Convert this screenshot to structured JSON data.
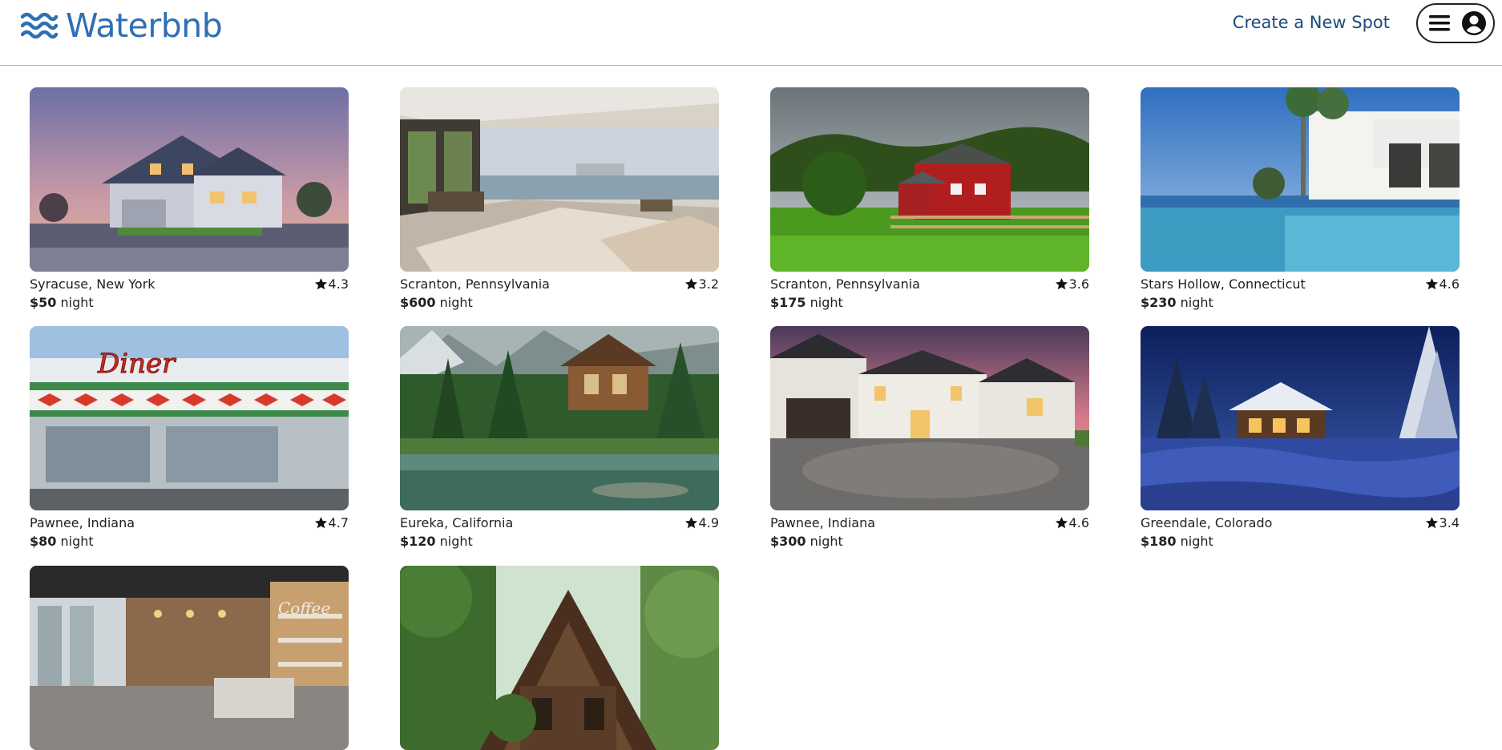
{
  "header": {
    "brand": "Waterbnb",
    "create_link": "Create a New Spot",
    "icons": {
      "logo": "waves-icon",
      "menu": "hamburger-icon",
      "profile": "user-circle-icon"
    }
  },
  "listings": [
    {
      "location": "Syracuse, New York",
      "rating": "4.3",
      "price": "$50",
      "unit": "night",
      "image": "suburban-house-photo"
    },
    {
      "location": "Scranton, Pennsylvania",
      "rating": "3.2",
      "price": "$600",
      "unit": "night",
      "image": "waterfront-bedroom-photo"
    },
    {
      "location": "Scranton, Pennsylvania",
      "rating": "3.6",
      "price": "$175",
      "unit": "night",
      "image": "red-barn-photo"
    },
    {
      "location": "Stars Hollow, Connecticut",
      "rating": "4.6",
      "price": "$230",
      "unit": "night",
      "image": "infinity-pool-villa-photo"
    },
    {
      "location": "Pawnee, Indiana",
      "rating": "4.7",
      "price": "$80",
      "unit": "night",
      "image": "diner-photo"
    },
    {
      "location": "Eureka, California",
      "rating": "4.9",
      "price": "$120",
      "unit": "night",
      "image": "lake-cabin-photo"
    },
    {
      "location": "Pawnee, Indiana",
      "rating": "4.6",
      "price": "$300",
      "unit": "night",
      "image": "modern-farmhouse-photo"
    },
    {
      "location": "Greendale, Colorado",
      "rating": "3.4",
      "price": "$180",
      "unit": "night",
      "image": "snowy-chalet-photo"
    },
    {
      "location": "",
      "rating": "",
      "price": "",
      "unit": "",
      "image": "coffee-shop-photo"
    },
    {
      "location": "",
      "rating": "",
      "price": "",
      "unit": "",
      "image": "forest-a-frame-photo"
    }
  ]
}
